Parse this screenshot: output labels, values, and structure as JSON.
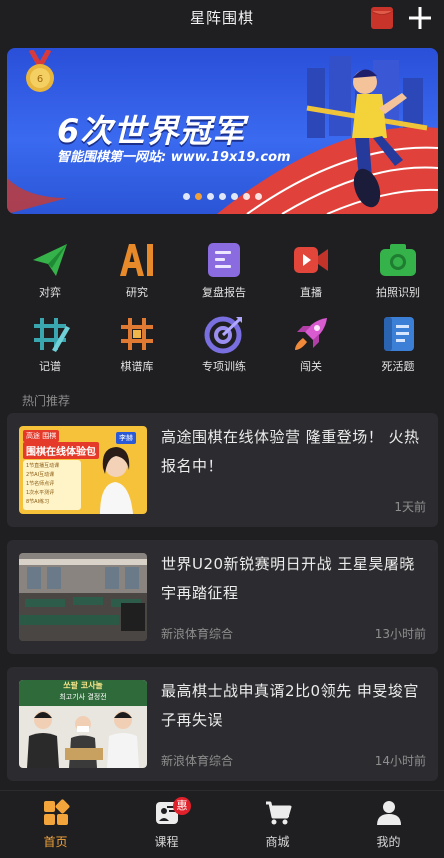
{
  "app": {
    "title": "星阵围棋"
  },
  "banner": {
    "slogan": "6次世界冠军",
    "subtitle": "智能围棋第一网站: www.19x19.com",
    "total_slides": 7,
    "active_slide": 1
  },
  "features": [
    {
      "label": "对弈",
      "icon": "paper-plane-icon"
    },
    {
      "label": "研究",
      "icon": "ai-icon"
    },
    {
      "label": "复盘报告",
      "icon": "report-icon"
    },
    {
      "label": "直播",
      "icon": "video-camera-icon"
    },
    {
      "label": "拍照识别",
      "icon": "camera-icon"
    },
    {
      "label": "记谱",
      "icon": "notation-icon"
    },
    {
      "label": "棋谱库",
      "icon": "board-library-icon"
    },
    {
      "label": "专项训练",
      "icon": "target-icon"
    },
    {
      "label": "闯关",
      "icon": "rocket-icon"
    },
    {
      "label": "死活题",
      "icon": "problem-book-icon"
    }
  ],
  "hot": {
    "title": "热门推荐",
    "articles": [
      {
        "title": "高途围棋在线体验营 隆重登场！ 火热报名中！",
        "source": "",
        "time": "1天前",
        "thumb": {
          "tag": "高途 围棋",
          "headline": "围棋在线体验包",
          "person": "李赫",
          "items": [
            "1节直播互动课",
            "2节AI互动课",
            "1节名师点评",
            "1次水平测评",
            "8节AI练习"
          ]
        }
      },
      {
        "title": "世界U20新锐赛明日开战 王星昊屠晓宇再踏征程",
        "source": "新浪体育综合",
        "time": "13小时前",
        "thumb": {}
      },
      {
        "title": "最高棋士战申真谞2比0领先 申旻埈官子再失误",
        "source": "新浪体育综合",
        "time": "14小时前",
        "thumb": {
          "banner_text": "쏘팔 코사놀",
          "banner_sub": "최고기사 결정전"
        }
      }
    ]
  },
  "tabs": [
    {
      "label": "首页",
      "icon": "home-icon",
      "active": true
    },
    {
      "label": "课程",
      "icon": "course-icon",
      "badge": "惠"
    },
    {
      "label": "商城",
      "icon": "cart-icon"
    },
    {
      "label": "我的",
      "icon": "profile-icon"
    }
  ],
  "colors": {
    "accent": "#f3a43b",
    "background": "#1f1f22",
    "card": "#2c2c30",
    "badge": "#e0212b"
  }
}
